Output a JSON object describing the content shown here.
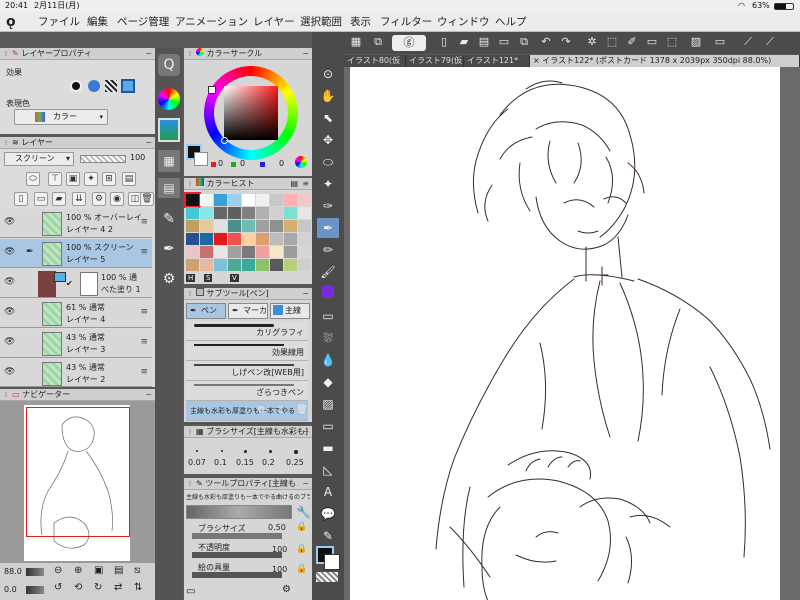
{
  "status": {
    "time": "20:41",
    "date": "2月11日(月)",
    "battery": "63%"
  },
  "menu": [
    "ファイル",
    "編集",
    "ページ管理",
    "アニメーション",
    "レイヤー",
    "選択範囲",
    "表示",
    "フィルター",
    "ウィンドウ",
    "ヘルプ"
  ],
  "layer_property": {
    "title": "レイヤープロパティ",
    "effect_label": "効果",
    "color_label": "表現色",
    "color_value": "カラー"
  },
  "layer_panel": {
    "title": "レイヤー",
    "blend_mode": "スクリーン",
    "opacity": "100",
    "layers": [
      {
        "line1": "100 % オーバーレイ",
        "line2": "レイヤー 4 2",
        "selected": false
      },
      {
        "line1": "100 % スクリーン",
        "line2": "レイヤー 5",
        "selected": true
      },
      {
        "line1": "100 % 通",
        "line2": "べた塗り 1",
        "selected": false
      },
      {
        "line1": "61 % 通常",
        "line2": "レイヤー 4",
        "selected": false
      },
      {
        "line1": "43 % 通常",
        "line2": "レイヤー 3",
        "selected": false
      },
      {
        "line1": "43 % 通常",
        "line2": "レイヤー 2",
        "selected": false
      }
    ]
  },
  "navigator": {
    "title": "ナビゲーター",
    "zoom": "88.0",
    "angle": "0.0"
  },
  "color_circle": {
    "title": "カラーサークル",
    "values": [
      "0",
      "0",
      "0"
    ]
  },
  "color_history": {
    "title": "カラーヒスト"
  },
  "subtool": {
    "title": "サブツール[ペン]",
    "tabs": [
      "ペン",
      "マーカ",
      "主線"
    ],
    "brushes": [
      "カリグラフィ",
      "効果線用",
      "しげペン改[WEB用]",
      "ざらつきペン",
      "主線も水彩も厚塗りも一本でやる"
    ]
  },
  "brush_size": {
    "title": "ブラシサイズ[主線も水彩も]",
    "sizes": [
      "0.07",
      "0.1",
      "0.15",
      "0.2",
      "0.25"
    ]
  },
  "tool_property": {
    "title": "ツールプロパティ[主線も",
    "brush_name": "主線も水彩も厚塗りも一本でやる曲けるのブラシ",
    "size_label": "ブラシサイズ",
    "size_value": "0.50",
    "opacity_label": "不透明度",
    "opacity_value": "100",
    "paint_label": "絵の具量",
    "paint_value": "100"
  },
  "tabs": [
    "イラスト80(仮",
    "イラスト79(仮",
    "イラスト121*",
    "イラスト122* (ポストカード 1378 x 2039px 350dpi 88.0%)"
  ],
  "colors": {
    "palette": [
      "#111111",
      "#f5f5f5",
      "#3aa0d8",
      "#9ad0f0",
      "#ffffff",
      "#f0f0f0",
      "#c8c8c8",
      "#ffb0b0",
      "#f0c8c8",
      "#44c7d4",
      "#88e6e6",
      "#666666",
      "#5f5f5f",
      "#808080",
      "#b0b0b0",
      "#d0d0d0",
      "#7de0d0",
      "#e5e5e5",
      "#c0a060",
      "#e6c89a",
      "#e0e0e0",
      "#4a8f8a",
      "#6fbcb4",
      "#a0a0a0",
      "#909090",
      "#d6b070",
      "#c7c7c7",
      "#2a4f8f",
      "#1d6aa0",
      "#e11b1b",
      "#f05050",
      "#ffd0a0",
      "#d9a070",
      "#bcbcbc",
      "#a8a8a8",
      "#d2d2d2",
      "#e8c7c7",
      "#c77070",
      "#e6e6e6",
      "#a0a0a0",
      "#7a7a7a",
      "#f0a0a0",
      "#f7e6c7",
      "#9c9c9c",
      "#d6d6d6",
      "#cfa070",
      "#e5b8a0",
      "#7ec0d8",
      "#4fa890",
      "#3aa89a",
      "#8fc06a",
      "#5a5a5a",
      "#b4d07a",
      "#cfcfcf"
    ]
  }
}
